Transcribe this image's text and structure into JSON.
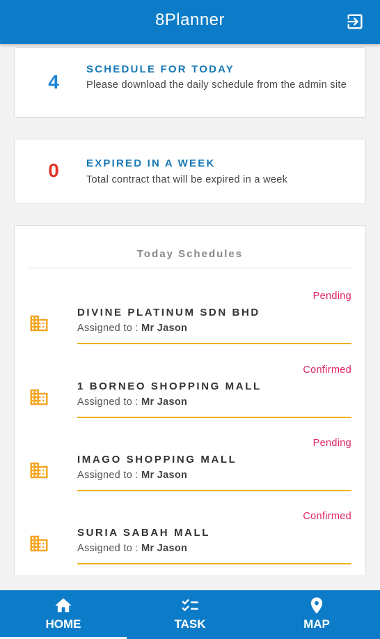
{
  "app": {
    "title": "8Planner"
  },
  "stats": [
    {
      "number": "4",
      "heading": "SCHEDULE FOR TODAY",
      "description": "Please download the daily schedule from the admin site",
      "color": "#1a86d6"
    },
    {
      "number": "0",
      "heading": "EXPIRED IN A WEEK",
      "description": "Total contract that will be expired in a week",
      "color": "#e0342a"
    }
  ],
  "schedules": {
    "title": "Today Schedules",
    "assigned_label": "Assigned to :",
    "items": [
      {
        "status": "Pending",
        "name": "DIVINE PLATINUM SDN BHD",
        "assignee": "Mr Jason"
      },
      {
        "status": "Confirmed",
        "name": "1 BORNEO SHOPPING MALL",
        "assignee": "Mr Jason"
      },
      {
        "status": "Pending",
        "name": "IMAGO SHOPPING MALL",
        "assignee": "Mr Jason"
      },
      {
        "status": "Confirmed",
        "name": "SURIA SABAH MALL",
        "assignee": "Mr Jason"
      }
    ]
  },
  "nav": {
    "home": "HOME",
    "task": "TASK",
    "map": "MAP",
    "active": "home"
  },
  "colors": {
    "primary": "#0d7cc8",
    "status": "#e0245e",
    "accent_line": "#f0b018",
    "building_icon": "#f5a623"
  }
}
